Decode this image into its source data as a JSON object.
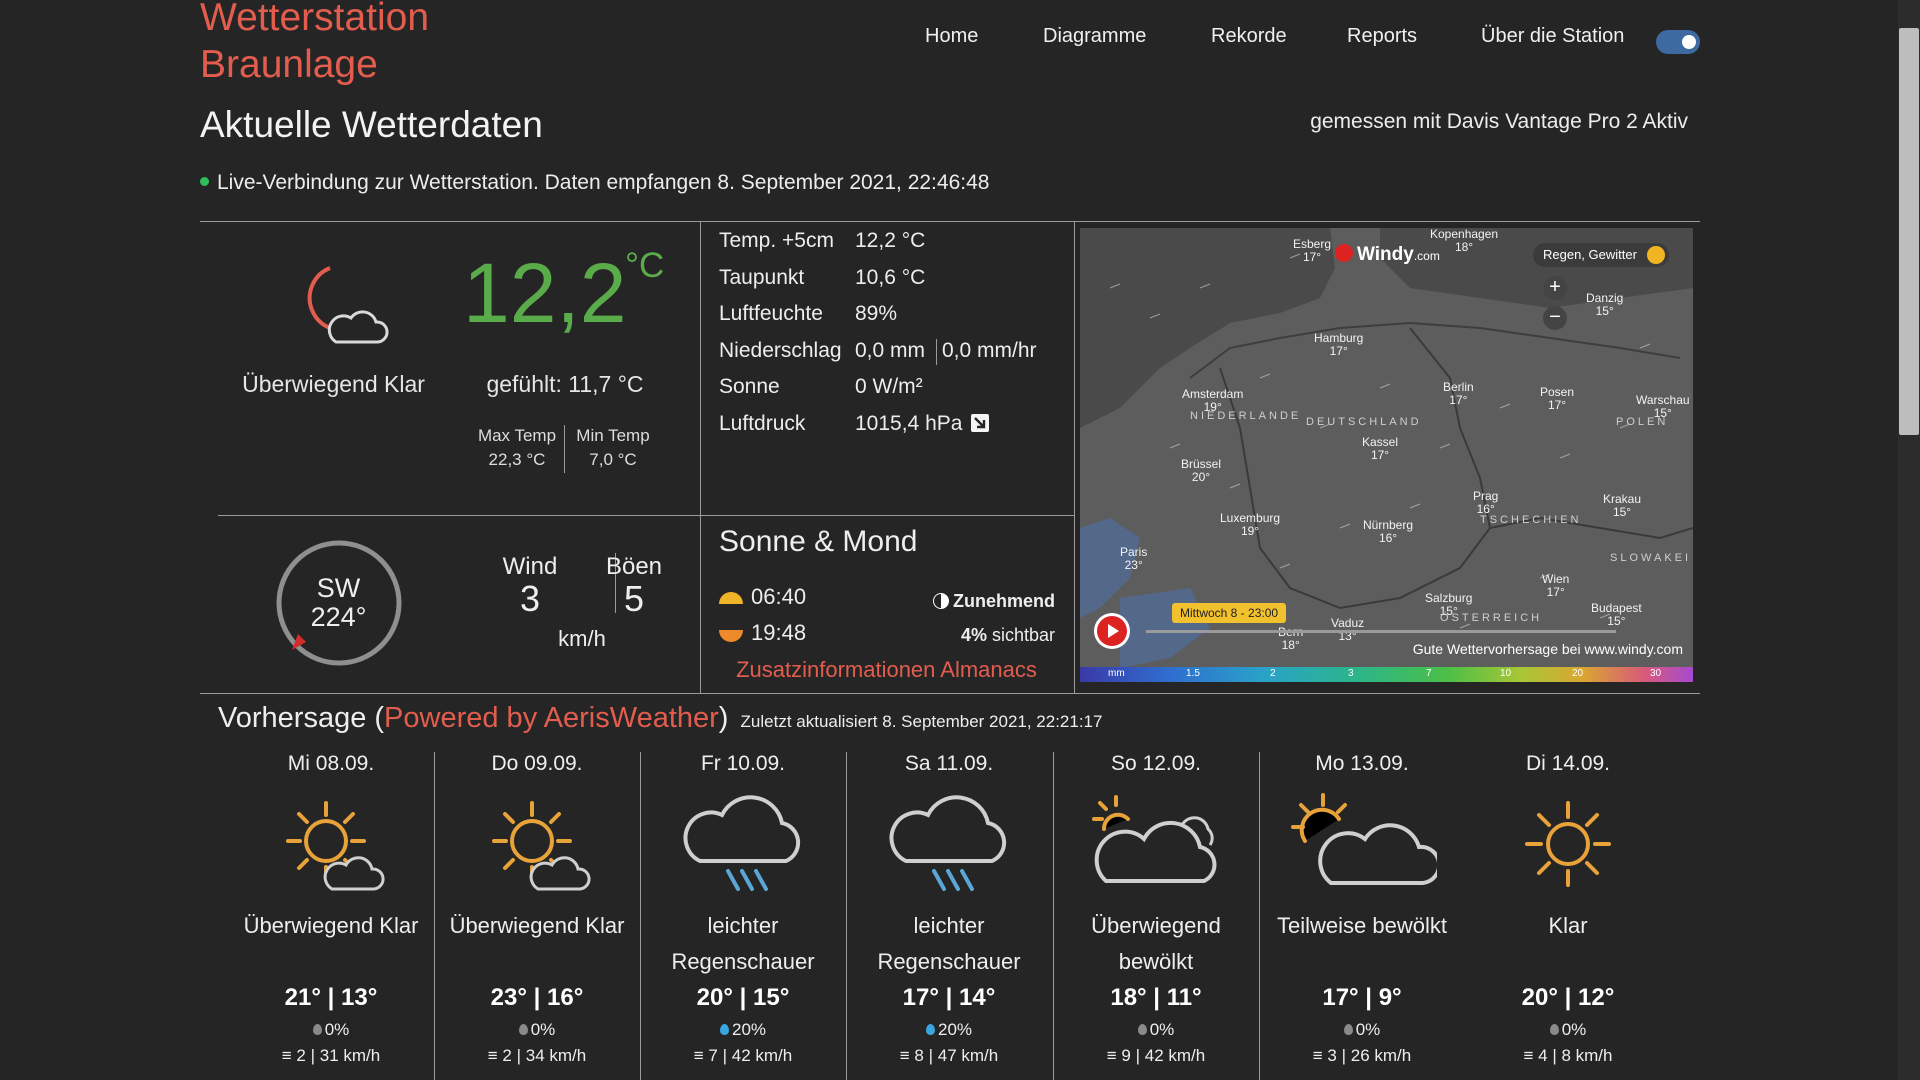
{
  "site": {
    "title_line1": "Wetterstation",
    "title_line2": "Braunlage"
  },
  "nav": [
    "Home",
    "Diagramme",
    "Rekorde",
    "Reports",
    "Über die Station"
  ],
  "heading": "Aktuelle Wetterdaten",
  "station_note": "gemessen mit Davis Vantage Pro 2 Aktiv",
  "live": "Live-Verbindung zur Wetterstation. Daten empfangen 8. September 2021, 22:46:48",
  "current": {
    "condition": "Überwiegend Klar",
    "temp": "12,2",
    "unit": "°C",
    "felt": "gefühlt: 11,7 °C",
    "max_label": "Max Temp",
    "max_value": "22,3 °C",
    "min_label": "Min Temp",
    "min_value": "7,0 °C"
  },
  "table": [
    {
      "label": "Temp. +5cm",
      "value": "12,2 °C"
    },
    {
      "label": "Taupunkt",
      "value": "10,6 °C"
    },
    {
      "label": "Luftfeuchte",
      "value": "89%"
    },
    {
      "label": "Niederschlag",
      "value": "0,0 mm",
      "value2": "0,0 mm/hr"
    },
    {
      "label": "Sonne",
      "value": "0 W/m²"
    },
    {
      "label": "Luftdruck",
      "value": "1015,4 hPa"
    }
  ],
  "wind": {
    "direction": "SW",
    "degrees": "224°",
    "wind_label": "Wind",
    "wind_value": "3",
    "gust_label": "Böen",
    "gust_value": "5",
    "unit": "km/h"
  },
  "sun_moon": {
    "title": "Sonne & Mond",
    "sunrise": "06:40",
    "sunset": "19:48",
    "phase": "Zunehmend",
    "visible_pct": "4%",
    "visible_label": "sichtbar",
    "link": "Zusatzinformationen Almanacs"
  },
  "map": {
    "brand": "Windy",
    "brand_suffix": ".com",
    "layer": "Regen, Gewitter",
    "zoom_in": "+",
    "zoom_out": "−",
    "time": "Mittwoch 8 - 23:00",
    "credit": "Gute Wettervorhersage bei www.windy.com",
    "scale": [
      "mm",
      "1.5",
      "2",
      "3",
      "7",
      "10",
      "20",
      "30"
    ],
    "cities": [
      {
        "name": "Esberg",
        "temp": "17°"
      },
      {
        "name": "Kopenhagen",
        "temp": "18°"
      },
      {
        "name": "Danzig",
        "temp": "15°"
      },
      {
        "name": "Hamburg",
        "temp": "17°"
      },
      {
        "name": "Amsterdam",
        "temp": "19°"
      },
      {
        "name": "Berlin",
        "temp": "17°"
      },
      {
        "name": "Posen",
        "temp": "17°"
      },
      {
        "name": "Warschau",
        "temp": "15°"
      },
      {
        "name": "Kassel",
        "temp": "17°"
      },
      {
        "name": "Brüssel",
        "temp": "20°"
      },
      {
        "name": "Luxemburg",
        "temp": "19°"
      },
      {
        "name": "Nürnberg",
        "temp": "16°"
      },
      {
        "name": "Prag",
        "temp": "16°"
      },
      {
        "name": "Krakau",
        "temp": "15°"
      },
      {
        "name": "Paris",
        "temp": "23°"
      },
      {
        "name": "Wien",
        "temp": "17°"
      },
      {
        "name": "Salzburg",
        "temp": "15°"
      },
      {
        "name": "Budapest",
        "temp": "15°"
      },
      {
        "name": "Vaduz",
        "temp": "13°"
      },
      {
        "name": "Bern",
        "temp": "18°"
      }
    ],
    "countries": [
      "NIEDERLANDE",
      "DEUTSCHLAND",
      "POLEN",
      "TSCHECHIEN",
      "SLOWAKEI",
      "ÖSTERREICH"
    ]
  },
  "forecast": {
    "title_prefix": "Vorhersage (",
    "powered": "Powered by AerisWeather",
    "title_suffix": ")",
    "updated": "Zuletzt aktualisiert 8. September 2021, 22:21:17",
    "days": [
      {
        "day": "Mi 08.09.",
        "icon": "sun-cloud-icon",
        "cond1": "Überwiegend Klar",
        "cond2": "",
        "temps": "21° | 13°",
        "rain": "0%",
        "wind": "2 | 31 km/h"
      },
      {
        "day": "Do 09.09.",
        "icon": "sun-cloud-icon",
        "cond1": "Überwiegend Klar",
        "cond2": "",
        "temps": "23° | 16°",
        "rain": "0%",
        "wind": "2 | 34 km/h"
      },
      {
        "day": "Fr 10.09.",
        "icon": "rain-cloud-icon",
        "cond1": "leichter",
        "cond2": "Regenschauer",
        "temps": "20° | 15°",
        "rain": "20%",
        "wind": "7 | 42 km/h"
      },
      {
        "day": "Sa 11.09.",
        "icon": "rain-cloud-icon",
        "cond1": "leichter",
        "cond2": "Regenschauer",
        "temps": "17° | 14°",
        "rain": "20%",
        "wind": "8 | 47 km/h"
      },
      {
        "day": "So 12.09.",
        "icon": "mostly-cloudy-icon",
        "cond1": "Überwiegend",
        "cond2": "bewölkt",
        "temps": "18° | 11°",
        "rain": "0%",
        "wind": "9 | 42 km/h"
      },
      {
        "day": "Mo 13.09.",
        "icon": "partly-cloudy-icon",
        "cond1": "Teilweise bewölkt",
        "cond2": "",
        "temps": "17° | 9°",
        "rain": "0%",
        "wind": "3 | 26 km/h"
      },
      {
        "day": "Di 14.09.",
        "icon": "sun-icon",
        "cond1": "Klar",
        "cond2": "",
        "temps": "20° | 12°",
        "rain": "0%",
        "wind": "4 | 8 km/h"
      }
    ]
  },
  "colors": {
    "accent": "#e35d4f",
    "temp_green": "#5aab4a",
    "live_dot": "#2fbf5a",
    "icon_orange": "#e8a23a",
    "rain_blue": "#3aa6e0"
  }
}
